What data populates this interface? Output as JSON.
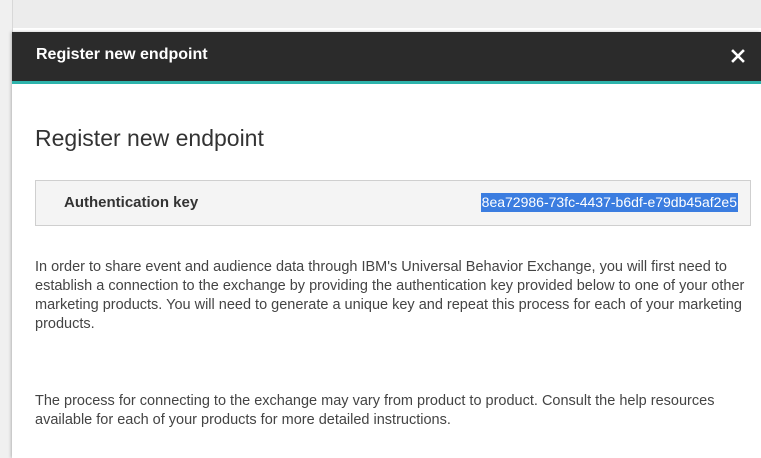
{
  "dialog": {
    "header_title": "Register new endpoint",
    "close_icon": "close-icon",
    "body_title": "Register new endpoint",
    "auth_key": {
      "label": "Authentication key",
      "value": "8ea72986-73fc-4437-b6df-e79db45af2e5"
    },
    "paragraphs": [
      "In order to share event and audience data through IBM's Universal Behavior Exchange, you will first need to establish a connection to the exchange by providing the authentication key provided below to one of your other marketing products. You will need to generate a unique key and repeat this process for each of your marketing products.",
      "The process for connecting to the exchange may vary from product to product. Consult the help resources available for each of your products for more detailed instructions."
    ]
  },
  "colors": {
    "header_bg": "#2b2b2b",
    "accent": "#2db3ab",
    "selection": "#3b7de0"
  }
}
